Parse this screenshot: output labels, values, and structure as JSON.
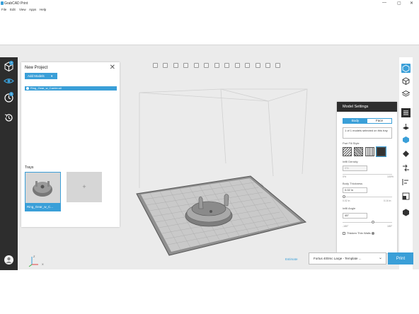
{
  "window": {
    "title": "GrabCAD Print",
    "controls": [
      "—",
      "▢",
      "✕"
    ]
  },
  "menu": [
    "File",
    "Edit",
    "View",
    "Apps",
    "Help"
  ],
  "left_rail": {
    "items": [
      {
        "name": "add-model",
        "badge": "+"
      },
      {
        "name": "projects",
        "badge": ""
      },
      {
        "name": "queue",
        "badge": "1"
      },
      {
        "name": "history",
        "badge": ""
      }
    ]
  },
  "project_panel": {
    "title": "New Project",
    "close_glyph": "✕",
    "add_models_label": "Add Models",
    "add_models_caret": "▾",
    "files": [
      "Ring_Gear_w_Carrier.stl"
    ],
    "trays_label": "Trays",
    "trays": [
      {
        "caption": "Ring_Gear_w_C..."
      }
    ],
    "add_tray_glyph": "+"
  },
  "model_settings": {
    "title": "Model Settings",
    "tabs": [
      "Body",
      "Face"
    ],
    "active_tab": "Body",
    "selection_note": "1 of 1 models selected on this tray",
    "part_fill_label": "Part Fill Style",
    "infill_density_label": "Infill Density",
    "infill_density_value": "0%",
    "infill_density_range": [
      "0%",
      "100%"
    ],
    "body_thickness_label": "Body Thickness",
    "body_thickness_value": "0.02 in",
    "body_thickness_range": [
      "0.02 in",
      "0.16 in"
    ],
    "infill_angle_label": "Infill Angle",
    "infill_angle_value": "45°",
    "infill_angle_range": [
      "-180°",
      "180°"
    ],
    "thicken_label": "Thicken Thin Walls",
    "body_thickness_fraction": 0.0,
    "infill_angle_fraction": 0.625
  },
  "bottom_bar": {
    "estimate_label": "Estimate",
    "printer_value": "Fortus 400mc Large - Template ...",
    "printer_chevron": "⌄",
    "print_label": "Print"
  },
  "axes_labels": {
    "x": "X",
    "z": "Z"
  },
  "colors": {
    "accent": "#3a9fd8",
    "rail_dark": "#2d2d2d",
    "grid_plate": "#9a9a9a",
    "model": "#8c8c8c"
  }
}
